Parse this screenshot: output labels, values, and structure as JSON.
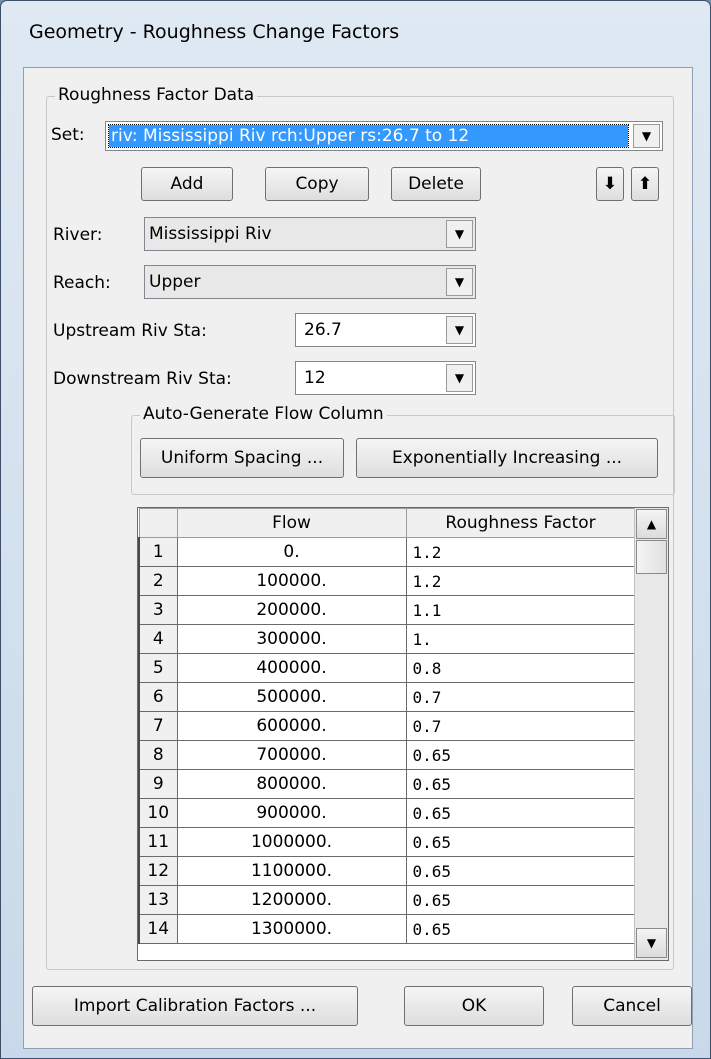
{
  "window": {
    "title": "Geometry - Roughness Change Factors"
  },
  "roughness_group": {
    "label": "Roughness Factor Data"
  },
  "set": {
    "label": "Set:",
    "value": "riv: Mississippi Riv rch:Upper rs:26.7  to 12"
  },
  "buttons": {
    "add": "Add",
    "copy": "Copy",
    "delete": "Delete",
    "move_down": "⬇",
    "move_up": "⬆"
  },
  "river": {
    "label": "River:",
    "value": "Mississippi Riv"
  },
  "reach": {
    "label": "Reach:",
    "value": "Upper"
  },
  "upstream": {
    "label": "Upstream Riv Sta:",
    "value": "26.7"
  },
  "downstream": {
    "label": "Downstream Riv Sta:",
    "value": "12"
  },
  "autogen": {
    "label": "Auto-Generate Flow Column",
    "uniform": "Uniform Spacing ...",
    "exponential": "Exponentially Increasing ..."
  },
  "table": {
    "columns": [
      "",
      "Flow",
      "Roughness Factor"
    ],
    "rows": [
      {
        "n": "1",
        "flow": "0.",
        "rf": "1.2"
      },
      {
        "n": "2",
        "flow": "100000.",
        "rf": "1.2"
      },
      {
        "n": "3",
        "flow": "200000.",
        "rf": "1.1"
      },
      {
        "n": "4",
        "flow": "300000.",
        "rf": "1."
      },
      {
        "n": "5",
        "flow": "400000.",
        "rf": "0.8"
      },
      {
        "n": "6",
        "flow": "500000.",
        "rf": "0.7"
      },
      {
        "n": "7",
        "flow": "600000.",
        "rf": "0.7"
      },
      {
        "n": "8",
        "flow": "700000.",
        "rf": "0.65"
      },
      {
        "n": "9",
        "flow": "800000.",
        "rf": "0.65"
      },
      {
        "n": "10",
        "flow": "900000.",
        "rf": "0.65"
      },
      {
        "n": "11",
        "flow": "1000000.",
        "rf": "0.65"
      },
      {
        "n": "12",
        "flow": "1100000.",
        "rf": "0.65"
      },
      {
        "n": "13",
        "flow": "1200000.",
        "rf": "0.65"
      },
      {
        "n": "14",
        "flow": "1300000.",
        "rf": "0.65"
      }
    ]
  },
  "footer": {
    "import": "Import Calibration Factors ...",
    "ok": "OK",
    "cancel": "Cancel"
  },
  "colors": {
    "selection": "#3399ff",
    "titlebar": "#c9d9e9"
  }
}
